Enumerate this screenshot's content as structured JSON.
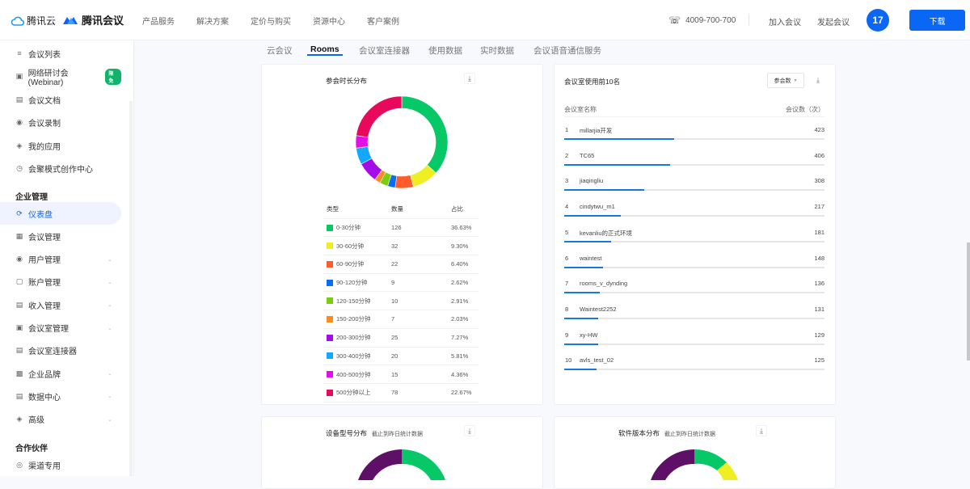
{
  "header": {
    "brand_cloud": "腾讯云",
    "brand_meeting": "腾讯会议",
    "nav": [
      "产品服务",
      "解决方案",
      "定价与购买",
      "资源中心",
      "客户案例"
    ],
    "phone": "4009-700-700",
    "join_meeting": "加入会议",
    "start_meeting": "发起会议",
    "avatar_text": "17",
    "download_label": "下载",
    "accent_color": "#0a66f5"
  },
  "sidebar": {
    "items_top": [
      {
        "label": "会议列表",
        "icon": "list-icon"
      },
      {
        "label": "网络研讨会(Webinar)",
        "icon": "webinar-icon",
        "badge": "限免"
      },
      {
        "label": "会议文档",
        "icon": "document-icon"
      },
      {
        "label": "会议录制",
        "icon": "record-icon"
      },
      {
        "label": "我的应用",
        "icon": "apps-icon"
      },
      {
        "label": "会聚模式创作中心",
        "icon": "creation-icon"
      }
    ],
    "section_enterprise": "企业管理",
    "items_enterprise": [
      {
        "label": "仪表盘",
        "icon": "dashboard-icon",
        "active": true
      },
      {
        "label": "会议管理",
        "icon": "grid-icon"
      },
      {
        "label": "用户管理",
        "icon": "user-icon",
        "expandable": true
      },
      {
        "label": "账户管理",
        "icon": "account-icon",
        "expandable": true
      },
      {
        "label": "收入管理",
        "icon": "income-icon",
        "expandable": true
      },
      {
        "label": "会议室管理",
        "icon": "room-icon",
        "expandable": true
      },
      {
        "label": "会议室连接器",
        "icon": "connector-icon"
      },
      {
        "label": "企业品牌",
        "icon": "brand-icon",
        "expandable": true
      },
      {
        "label": "数据中心",
        "icon": "data-icon",
        "expandable": true
      },
      {
        "label": "高级",
        "icon": "advanced-icon",
        "expandable": true
      }
    ],
    "section_partner": "合作伙伴",
    "items_partner": [
      {
        "label": "渠道专用",
        "icon": "channel-icon"
      }
    ]
  },
  "tabs": [
    {
      "label": "云会议",
      "active": false
    },
    {
      "label": "Rooms",
      "active": true
    },
    {
      "label": "会议室连接器",
      "active": false
    },
    {
      "label": "使用数据",
      "active": false
    },
    {
      "label": "实时数据",
      "active": false
    },
    {
      "label": "会议语音通信服务",
      "active": false
    }
  ],
  "duration_card": {
    "title": "参会时长分布",
    "columns": [
      "类型",
      "数量",
      "占比"
    ]
  },
  "ranking_card": {
    "title": "会议室使用前10名",
    "sort_select": "参会数",
    "col_name": "会议室名称",
    "col_count": "会议数（次）",
    "max_value": 1000,
    "rows": [
      {
        "rank": "1",
        "name": "millarjia开发",
        "value": 423
      },
      {
        "rank": "2",
        "name": "TC65",
        "value": 406
      },
      {
        "rank": "3",
        "name": "jiaqingliu",
        "value": 308
      },
      {
        "rank": "4",
        "name": "cindytwu_m1",
        "value": 217
      },
      {
        "rank": "5",
        "name": "kevanliu的正式环境",
        "value": 181
      },
      {
        "rank": "6",
        "name": "waintest",
        "value": 148
      },
      {
        "rank": "7",
        "name": "rooms_v_dynding",
        "value": 136
      },
      {
        "rank": "8",
        "name": "Waintest2252",
        "value": 131
      },
      {
        "rank": "9",
        "name": "xy-HW",
        "value": 129
      },
      {
        "rank": "10",
        "name": "avls_test_02",
        "value": 125
      }
    ]
  },
  "device_card": {
    "title": "设备型号分布",
    "subtitle": "截止到昨日统计数据",
    "colors": [
      "#06c867",
      "#5e0f66"
    ]
  },
  "software_card": {
    "title": "软件版本分布",
    "subtitle": "截止到昨日统计数据",
    "colors": [
      "#06c867",
      "#eeee22",
      "#5e0f66"
    ]
  },
  "chart_data": {
    "type": "pie",
    "title": "参会时长分布",
    "categories": [
      "0-30分钟",
      "30-60分钟",
      "60-90分钟",
      "90-120分钟",
      "120-150分钟",
      "150-200分钟",
      "200-300分钟",
      "300-400分钟",
      "400-500分钟",
      "500分钟以上"
    ],
    "values": [
      126,
      32,
      22,
      9,
      10,
      7,
      25,
      20,
      15,
      78
    ],
    "percents": [
      "36.63%",
      "9.30%",
      "6.40%",
      "2.62%",
      "2.91%",
      "2.03%",
      "7.27%",
      "5.81%",
      "4.36%",
      "22.67%"
    ],
    "colors": [
      "#06c867",
      "#eeee22",
      "#ff5c2e",
      "#0a6cf5",
      "#7ccc10",
      "#ff8a1f",
      "#a40ce8",
      "#12a8ff",
      "#e30ee8",
      "#e8085c"
    ],
    "donut": true,
    "legend": "table-below"
  }
}
